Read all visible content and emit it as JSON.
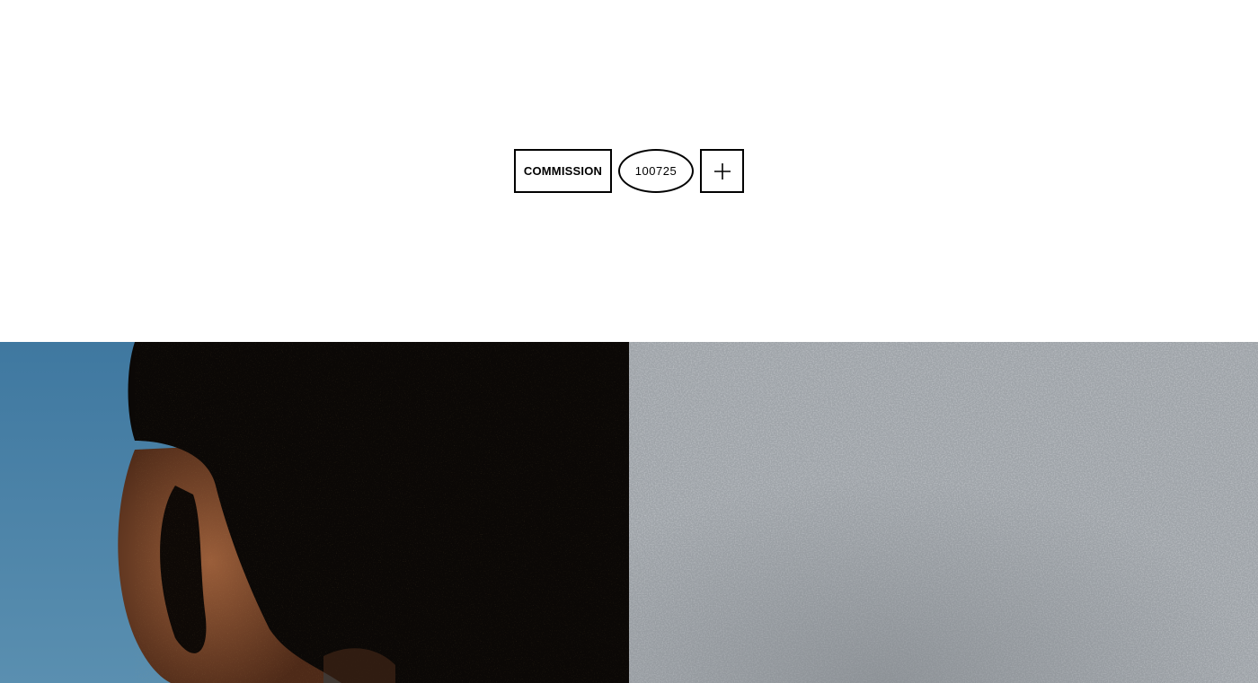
{
  "logo": {
    "commission_label": "COMMISSION",
    "number_label": "100725",
    "plus_icon": "plus-icon"
  },
  "colors": {
    "background": "#ffffff",
    "ink": "#000000",
    "sky_blue": "#4a82a8",
    "hair_dark": "#0b0806",
    "skin": "#7a4a30",
    "gray_texture": "#9ea3a8"
  },
  "gallery": {
    "images": [
      {
        "name": "portrait-photo",
        "subject": "close-up of a person's head against blue sky"
      },
      {
        "name": "gray-texture-photo",
        "subject": "gray textured surface"
      }
    ]
  }
}
